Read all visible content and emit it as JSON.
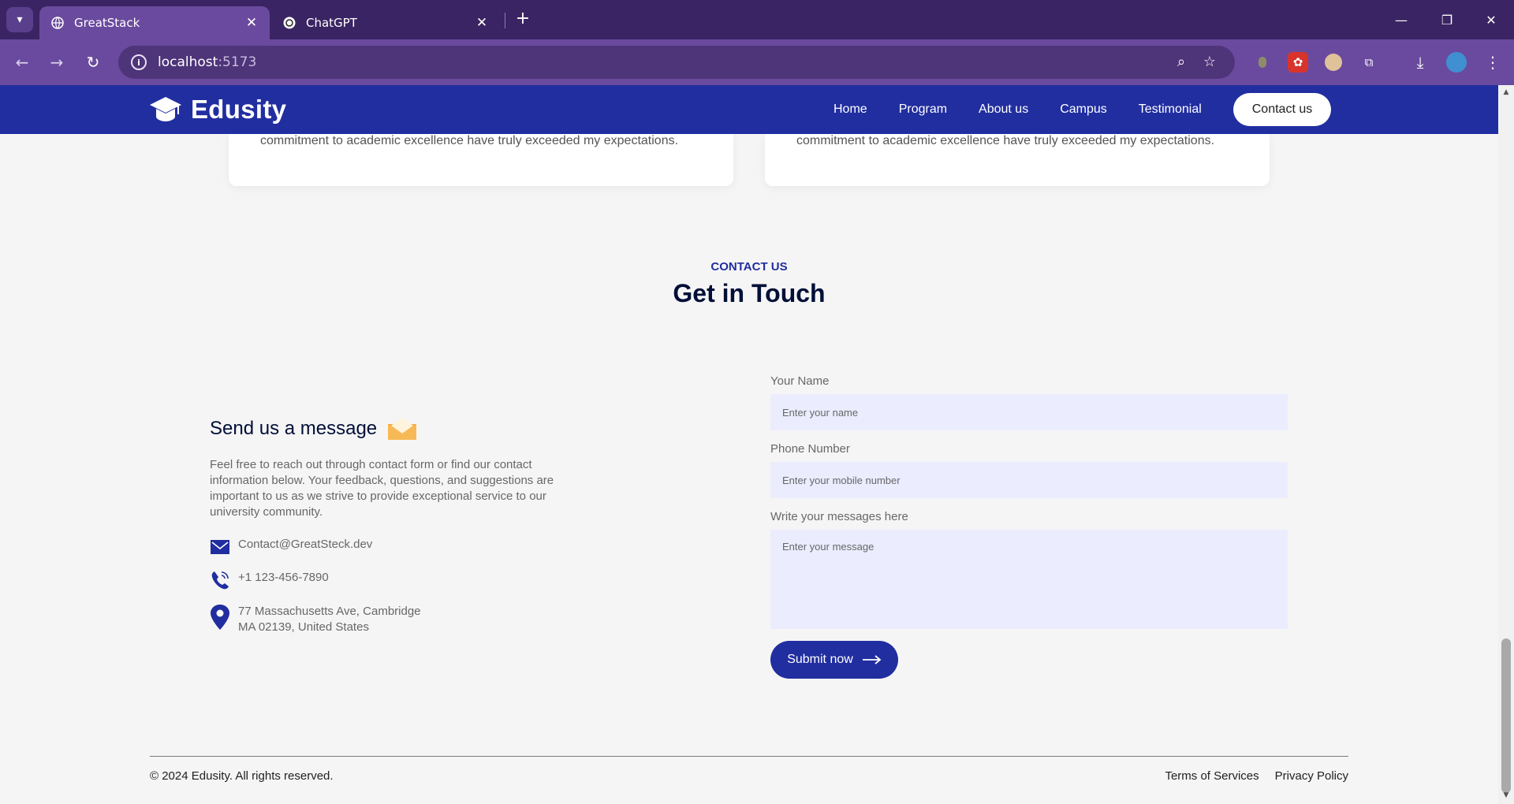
{
  "browser": {
    "tabs": [
      {
        "title": "GreatStack",
        "icon": "globe-icon"
      },
      {
        "title": "ChatGPT",
        "icon": "chatgpt-icon"
      }
    ],
    "url_host": "localhost",
    "url_port": ":5173",
    "accent": "#6a4a9e"
  },
  "site": {
    "logo": "Edusity",
    "nav": [
      "Home",
      "Program",
      "About us",
      "Campus",
      "Testimonial"
    ],
    "contact_button": "Contact us",
    "brand_color": "#212ea0"
  },
  "testimonials": {
    "tail_text": "commitment to academic excellence have truly exceeded my expectations."
  },
  "contact": {
    "subtitle": "CONTACT US",
    "title": "Get in Touch",
    "left": {
      "heading": "Send us a message",
      "description": "Feel free to reach out through contact form or find our contact information below. Your feedback, questions, and suggestions are important to us as we strive to provide exceptional service to our university community.",
      "email": "Contact@GreatSteck.dev",
      "phone": "+1 123-456-7890",
      "address_line1": "77 Massachusetts Ave, Cambridge",
      "address_line2": "MA 02139, United States"
    },
    "form": {
      "name_label": "Your Name",
      "name_placeholder": "Enter your name",
      "phone_label": "Phone Number",
      "phone_placeholder": "Enter your mobile number",
      "message_label": "Write your messages here",
      "message_placeholder": "Enter your message",
      "submit_label": "Submit now"
    }
  },
  "footer": {
    "copyright": "© 2024 Edusity. All rights reserved.",
    "links": [
      "Terms of Services",
      "Privacy Policy"
    ]
  }
}
